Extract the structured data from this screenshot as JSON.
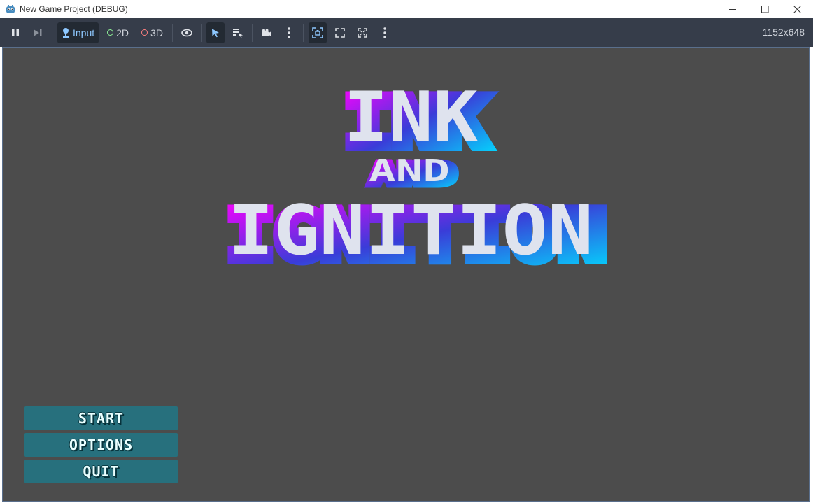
{
  "window": {
    "title": "New Game Project (DEBUG)"
  },
  "toolbar": {
    "input_label": "Input",
    "mode_2d_label": "2D",
    "mode_3d_label": "3D",
    "resolution": "1152x648"
  },
  "game": {
    "logo_line1": "INK",
    "logo_line2": "AND",
    "logo_line3": "IGNITION",
    "menu": {
      "start": "START",
      "options": "OPTIONS",
      "quit": "QUIT"
    }
  },
  "colors": {
    "toolbar_bg": "#363d4a",
    "viewport_bg": "#4c4c4c",
    "button_bg": "#27707d",
    "logo_gradient_start": "#ff00ff",
    "logo_gradient_mid": "#3a3cd8",
    "logo_gradient_end": "#00e0ff",
    "logo_face": "#dfe3ee"
  }
}
